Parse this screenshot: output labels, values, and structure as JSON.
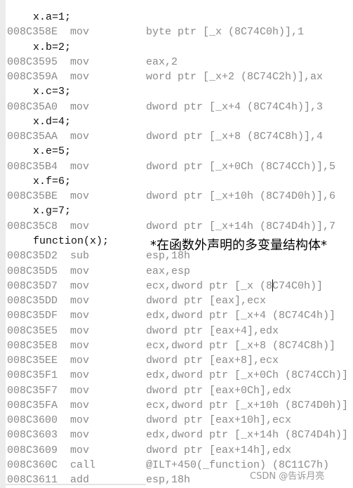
{
  "lines": [
    {
      "type": "src",
      "text": "x.a=1;"
    },
    {
      "type": "asm",
      "addr": "008C358E",
      "mn": "mov",
      "op": "byte ptr [_x (8C74C0h)],1"
    },
    {
      "type": "src",
      "text": "x.b=2;"
    },
    {
      "type": "asm",
      "addr": "008C3595",
      "mn": "mov",
      "op": "eax,2"
    },
    {
      "type": "asm",
      "addr": "008C359A",
      "mn": "mov",
      "op": "word ptr [_x+2 (8C74C2h)],ax"
    },
    {
      "type": "src",
      "text": "x.c=3;"
    },
    {
      "type": "asm",
      "addr": "008C35A0",
      "mn": "mov",
      "op": "dword ptr [_x+4 (8C74C4h)],3"
    },
    {
      "type": "src",
      "text": "x.d=4;"
    },
    {
      "type": "asm",
      "addr": "008C35AA",
      "mn": "mov",
      "op": "dword ptr [_x+8 (8C74C8h)],4"
    },
    {
      "type": "src",
      "text": "x.e=5;"
    },
    {
      "type": "asm",
      "addr": "008C35B4",
      "mn": "mov",
      "op": "dword ptr [_x+0Ch (8C74CCh)],5"
    },
    {
      "type": "src",
      "text": "x.f=6;"
    },
    {
      "type": "asm",
      "addr": "008C35BE",
      "mn": "mov",
      "op": "dword ptr [_x+10h (8C74D0h)],6"
    },
    {
      "type": "src",
      "text": "x.g=7;"
    },
    {
      "type": "asm",
      "addr": "008C35C8",
      "mn": "mov",
      "op": "dword ptr [_x+14h (8C74D4h)],7"
    },
    {
      "type": "src",
      "text": "function(x);"
    },
    {
      "type": "asm",
      "addr": "008C35D2",
      "mn": "sub",
      "op": "esp,18h"
    },
    {
      "type": "asm",
      "addr": "008C35D5",
      "mn": "mov",
      "op": "eax,esp"
    },
    {
      "type": "asm",
      "addr": "008C35D7",
      "mn": "mov",
      "op": "ecx,dword ptr [_x (8C74C0h)]"
    },
    {
      "type": "asm",
      "addr": "008C35DD",
      "mn": "mov",
      "op": "dword ptr [eax],ecx"
    },
    {
      "type": "asm",
      "addr": "008C35DF",
      "mn": "mov",
      "op": "edx,dword ptr [_x+4 (8C74C4h)]"
    },
    {
      "type": "asm",
      "addr": "008C35E5",
      "mn": "mov",
      "op": "dword ptr [eax+4],edx"
    },
    {
      "type": "asm",
      "addr": "008C35E8",
      "mn": "mov",
      "op": "ecx,dword ptr [_x+8 (8C74C8h)]"
    },
    {
      "type": "asm",
      "addr": "008C35EE",
      "mn": "mov",
      "op": "dword ptr [eax+8],ecx"
    },
    {
      "type": "asm",
      "addr": "008C35F1",
      "mn": "mov",
      "op": "edx,dword ptr [_x+0Ch (8C74CCh)]"
    },
    {
      "type": "asm",
      "addr": "008C35F7",
      "mn": "mov",
      "op": "dword ptr [eax+0Ch],edx"
    },
    {
      "type": "asm",
      "addr": "008C35FA",
      "mn": "mov",
      "op": "ecx,dword ptr [_x+10h (8C74D0h)]"
    },
    {
      "type": "asm",
      "addr": "008C3600",
      "mn": "mov",
      "op": "dword ptr [eax+10h],ecx"
    },
    {
      "type": "asm",
      "addr": "008C3603",
      "mn": "mov",
      "op": "edx,dword ptr [_x+14h (8C74D4h)]"
    },
    {
      "type": "asm",
      "addr": "008C3609",
      "mn": "mov",
      "op": "dword ptr [eax+14h],edx"
    },
    {
      "type": "asm",
      "addr": "008C360C",
      "mn": "call",
      "op": "@ILT+450(_function) (8C11C7h)"
    },
    {
      "type": "asm",
      "addr": "008C3611",
      "mn": "add",
      "op": "esp,18h"
    }
  ],
  "annotation": "*在函数外声明的多变量结构体*",
  "watermark": "CSDN @告诉月亮",
  "colors": {
    "source_text": "#111111",
    "asm_text": "#8a8a8a",
    "gutter": "#ececec"
  }
}
